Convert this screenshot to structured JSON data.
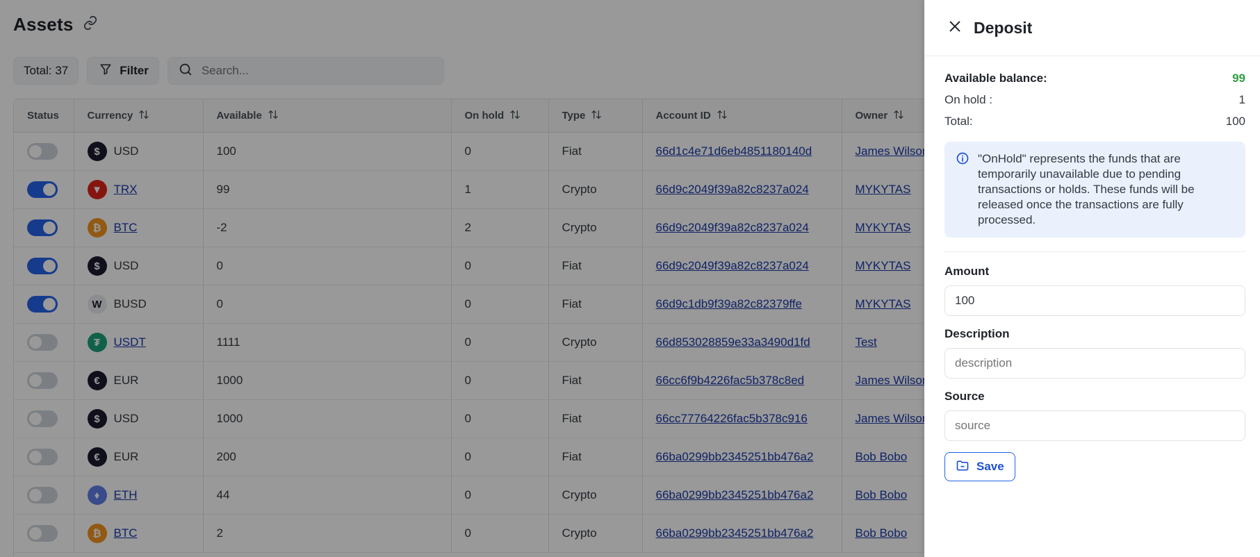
{
  "header": {
    "title": "Assets"
  },
  "toolbar": {
    "total_label": "Total: 37",
    "filter_label": "Filter",
    "search_placeholder": "Search..."
  },
  "table": {
    "columns": [
      "Status",
      "Currency",
      "Available",
      "On hold",
      "Type",
      "Account ID",
      "Owner"
    ],
    "rows": [
      {
        "status_on": false,
        "currency": "USD",
        "currency_link": false,
        "icon": "dollar-icon",
        "icon_color": "#1b1b2f",
        "available": "100",
        "on_hold": "0",
        "type": "Fiat",
        "account_id": "66d1c4e71d6eb4851180140d",
        "owner": "James Wilson"
      },
      {
        "status_on": true,
        "currency": "TRX",
        "currency_link": true,
        "icon": "tron-icon",
        "icon_color": "#e0231b",
        "available": "99",
        "on_hold": "1",
        "type": "Crypto",
        "account_id": "66d9c2049f39a82c8237a024",
        "owner": "MYKYTAS"
      },
      {
        "status_on": true,
        "currency": "BTC",
        "currency_link": true,
        "icon": "bitcoin-icon",
        "icon_color": "#f2951e",
        "available": "-2",
        "on_hold": "2",
        "type": "Crypto",
        "account_id": "66d9c2049f39a82c8237a024",
        "owner": "MYKYTAS"
      },
      {
        "status_on": true,
        "currency": "USD",
        "currency_link": false,
        "icon": "dollar-icon",
        "icon_color": "#1b1b2f",
        "available": "0",
        "on_hold": "0",
        "type": "Fiat",
        "account_id": "66d9c2049f39a82c8237a024",
        "owner": "MYKYTAS"
      },
      {
        "status_on": true,
        "currency": "BUSD",
        "currency_link": false,
        "icon": "w-letter-icon",
        "icon_color": "#e9ecef",
        "available": "0",
        "on_hold": "0",
        "type": "Fiat",
        "account_id": "66d9c1db9f39a82c82379ffe",
        "owner": "MYKYTAS"
      },
      {
        "status_on": false,
        "currency": "USDT",
        "currency_link": true,
        "icon": "tether-icon",
        "icon_color": "#1ba27a",
        "available": "1111",
        "on_hold": "0",
        "type": "Crypto",
        "account_id": "66d853028859e33a3490d1fd",
        "owner": "Test"
      },
      {
        "status_on": false,
        "currency": "EUR",
        "currency_link": false,
        "icon": "euro-icon",
        "icon_color": "#1b1b2f",
        "available": "1000",
        "on_hold": "0",
        "type": "Fiat",
        "account_id": "66cc6f9b4226fac5b378c8ed",
        "owner": "James Wilson"
      },
      {
        "status_on": false,
        "currency": "USD",
        "currency_link": false,
        "icon": "dollar-icon",
        "icon_color": "#1b1b2f",
        "available": "1000",
        "on_hold": "0",
        "type": "Fiat",
        "account_id": "66cc77764226fac5b378c916",
        "owner": "James Wilson"
      },
      {
        "status_on": false,
        "currency": "EUR",
        "currency_link": false,
        "icon": "euro-icon",
        "icon_color": "#1b1b2f",
        "available": "200",
        "on_hold": "0",
        "type": "Fiat",
        "account_id": "66ba0299bb2345251bb476a2",
        "owner": "Bob Bobo"
      },
      {
        "status_on": false,
        "currency": "ETH",
        "currency_link": true,
        "icon": "ethereum-icon",
        "icon_color": "#627eea",
        "available": "44",
        "on_hold": "0",
        "type": "Crypto",
        "account_id": "66ba0299bb2345251bb476a2",
        "owner": "Bob Bobo"
      },
      {
        "status_on": false,
        "currency": "BTC",
        "currency_link": true,
        "icon": "bitcoin-icon",
        "icon_color": "#f2951e",
        "available": "2",
        "on_hold": "0",
        "type": "Crypto",
        "account_id": "66ba0299bb2345251bb476a2",
        "owner": "Bob Bobo"
      }
    ]
  },
  "panel": {
    "title": "Deposit",
    "available_label": "Available balance:",
    "available_value": "99",
    "on_hold_label": "On hold :",
    "on_hold_value": "1",
    "total_label": "Total:",
    "total_value": "100",
    "info_text": "\"OnHold\" represents the funds that are temporarily unavailable due to pending transactions or holds. These funds will be released once the transactions are fully processed.",
    "amount_label": "Amount",
    "amount_value": "100",
    "description_label": "Description",
    "description_placeholder": "description",
    "source_label": "Source",
    "source_placeholder": "source",
    "save_label": "Save"
  },
  "colors": {
    "accent": "#2563eb",
    "link": "#1c3aa9",
    "positive": "#2f9e44",
    "info_bg": "#eaf1fd"
  }
}
